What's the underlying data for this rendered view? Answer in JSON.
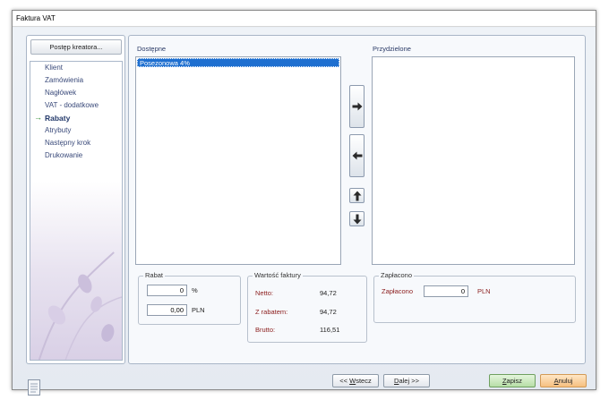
{
  "window": {
    "title": "Faktura VAT"
  },
  "wizard": {
    "progress_button": "Postęp kreatora...",
    "steps": [
      {
        "label": "Klient",
        "active": false
      },
      {
        "label": "Zamówienia",
        "active": false
      },
      {
        "label": "Nagłówek",
        "active": false
      },
      {
        "label": "VAT - dodatkowe",
        "active": false
      },
      {
        "label": "Rabaty",
        "active": true
      },
      {
        "label": "Atrybuty",
        "active": false
      },
      {
        "label": "Następny krok",
        "active": false
      },
      {
        "label": "Drukowanie",
        "active": false
      }
    ],
    "active_arrow": "→"
  },
  "available": {
    "label": "Dostępne",
    "items": [
      "Posezonowa 4%"
    ]
  },
  "assigned": {
    "label": "Przydzielone",
    "items": []
  },
  "move_buttons": [
    "move-right",
    "move-left",
    "move-up",
    "move-down"
  ],
  "rabat": {
    "label": "Rabat",
    "percent_value": "0",
    "percent_unit": "%",
    "amount_value": "0,00",
    "amount_unit": "PLN"
  },
  "invoice_value": {
    "label": "Wartość faktury",
    "netto_label": "Netto:",
    "netto_value": "94,72",
    "z_rabatem_label": "Z rabatem:",
    "z_rabatem_value": "94,72",
    "brutto_label": "Brutto:",
    "brutto_value": "116,51"
  },
  "paid": {
    "label": "Zapłacono",
    "field_label": "Zapłacono",
    "value": "0",
    "unit": "PLN"
  },
  "nav": {
    "back_prefix": "<< ",
    "back_u": "W",
    "back_rest": "stecz",
    "next_u": "D",
    "next_rest": "alej >>",
    "save_u": "Z",
    "save_rest": "apisz",
    "cancel_u": "A",
    "cancel_rest": "nuluj"
  }
}
